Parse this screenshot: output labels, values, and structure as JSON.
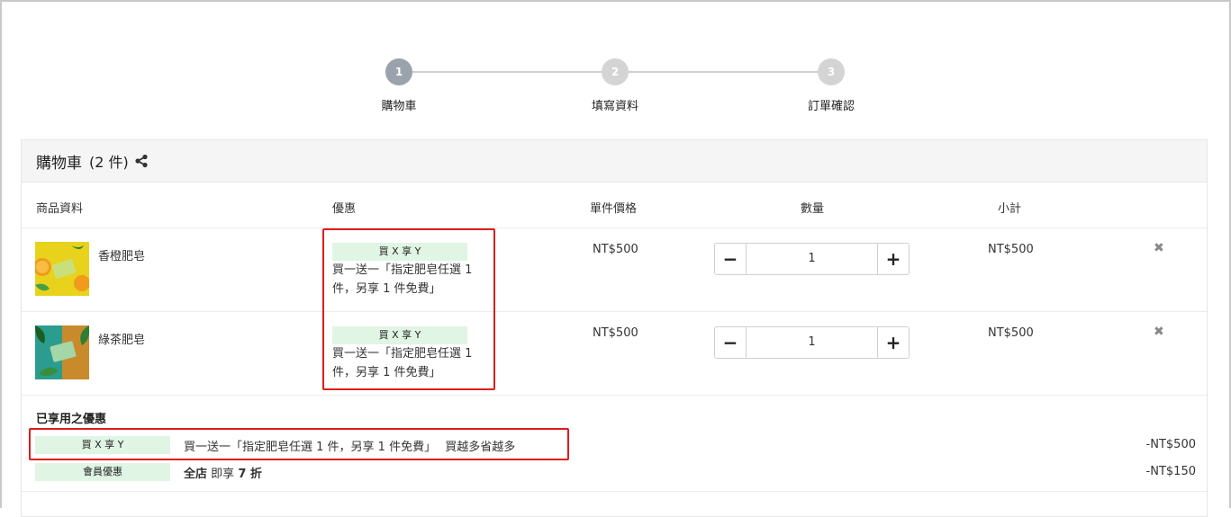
{
  "stepper": {
    "steps": [
      {
        "num": "1",
        "label": "購物車",
        "active": true
      },
      {
        "num": "2",
        "label": "填寫資料",
        "active": false
      },
      {
        "num": "3",
        "label": "訂單確認",
        "active": false
      }
    ]
  },
  "cart": {
    "title": "購物車",
    "count": "(2 件)",
    "share_icon": "share-icon",
    "headers": {
      "product": "商品資料",
      "promo": "優惠",
      "unit_price": "單件價格",
      "quantity": "數量",
      "subtotal": "小計"
    },
    "items": [
      {
        "name": "香橙肥皂",
        "promo_badge": "買 X 享 Y",
        "promo_text": "買一送一「指定肥皂任選 1 件，另享 1 件免費」",
        "unit_price": "NT$500",
        "quantity": "1",
        "subtotal": "NT$500",
        "thumb_color": "#e8c81a"
      },
      {
        "name": "綠茶肥皂",
        "promo_badge": "買 X 享 Y",
        "promo_text": "買一送一「指定肥皂任選 1 件，另享 1 件免費」",
        "unit_price": "NT$500",
        "quantity": "1",
        "subtotal": "NT$500",
        "thumb_color": "#2a9d8f"
      }
    ],
    "applied": {
      "title": "已享用之優惠",
      "discounts": [
        {
          "badge": "買 X 享 Y",
          "text": "買一送一「指定肥皂任選 1 件，另享 1 件免費」",
          "extra": "買越多省越多",
          "amount": "-NT$500"
        },
        {
          "badge": "會員優惠",
          "text_bold": "全店",
          "text": "即享",
          "text_bold2": "7 折",
          "amount": "-NT$150"
        }
      ]
    }
  },
  "colors": {
    "badge_bg": "#e0f5e4",
    "highlight": "#e01b1b",
    "step_active": "#9aa3ab",
    "step_inactive": "#d4d4d4"
  }
}
